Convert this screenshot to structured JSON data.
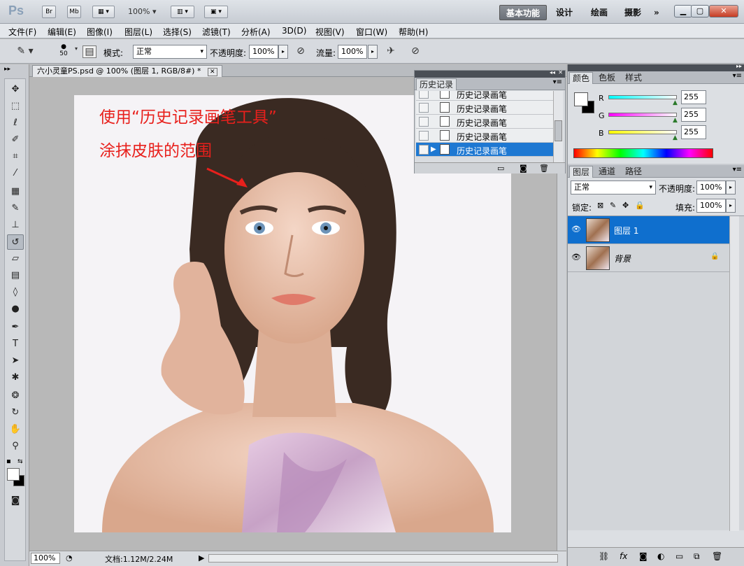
{
  "app": {
    "logo": "Ps",
    "bridge": "Br",
    "minibridge": "Mb",
    "zoom": "100%",
    "workspaces": [
      "基本功能",
      "设计",
      "绘画",
      "摄影"
    ],
    "more": "»"
  },
  "menu": [
    "文件(F)",
    "编辑(E)",
    "图像(I)",
    "图层(L)",
    "选择(S)",
    "滤镜(T)",
    "分析(A)",
    "3D(D)",
    "视图(V)",
    "窗口(W)",
    "帮助(H)"
  ],
  "options": {
    "brush_size": "50",
    "mode_label": "模式:",
    "mode_value": "正常",
    "opacity_label": "不透明度:",
    "opacity_value": "100%",
    "flow_label": "流量:",
    "flow_value": "100%"
  },
  "document": {
    "tab_title": "六小灵童PS.psd @ 100% (图层 1, RGB/8#) *",
    "annotation_line1": "使用“历史记录画笔工具”",
    "annotation_line2": "涂抹皮肤的范围"
  },
  "status": {
    "zoom": "100%",
    "doc_info": "文档:1.12M/2.24M"
  },
  "history": {
    "tab": "历史记录",
    "items": [
      "历史记录画笔",
      "历史记录画笔",
      "历史记录画笔",
      "历史记录画笔",
      "历史记录画笔"
    ],
    "selected_index": 4
  },
  "color_panel": {
    "tabs": [
      "颜色",
      "色板",
      "样式"
    ],
    "r_label": "R",
    "r": "255",
    "g_label": "G",
    "g": "255",
    "b_label": "B",
    "b": "255"
  },
  "layers_panel": {
    "tabs": [
      "图层",
      "通道",
      "路径"
    ],
    "blend_mode": "正常",
    "opacity_label": "不透明度:",
    "opacity": "100%",
    "lock_label": "锁定:",
    "fill_label": "填充:",
    "fill": "100%",
    "layers": [
      {
        "name": "图层 1",
        "selected": true
      },
      {
        "name": "背景",
        "selected": false
      }
    ]
  },
  "colors": {
    "accent": "#0f6fce",
    "annotation": "#e8201c"
  }
}
